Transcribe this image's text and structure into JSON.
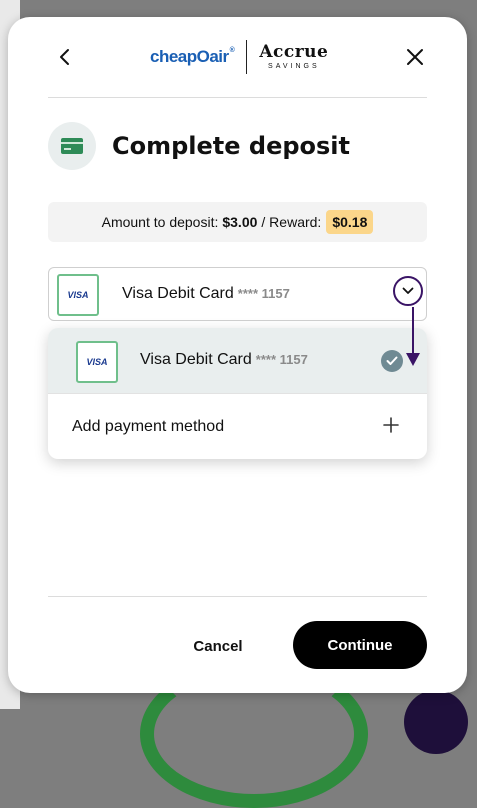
{
  "header": {
    "brand_left": "cheapOair",
    "brand_left_mark": "®",
    "brand_right": "Accrue",
    "brand_right_sub": "SAVINGS"
  },
  "title": "Complete deposit",
  "amount": {
    "label": "Amount to deposit:",
    "value": "$3.00",
    "separator": "/ Reward:",
    "reward": "$0.18"
  },
  "payment_select": {
    "card_brand": "VISA",
    "card_name": "Visa Debit Card",
    "card_mask": "**** 1157"
  },
  "dropdown": {
    "items": [
      {
        "card_brand": "VISA",
        "card_name": "Visa Debit Card",
        "card_mask": "**** 1157",
        "selected": true
      }
    ],
    "add_label": "Add payment method"
  },
  "footer": {
    "cancel_label": "Cancel",
    "continue_label": "Continue"
  },
  "colors": {
    "accent_purple": "#3a1466",
    "reward_badge": "#fbd68a",
    "card_border_green": "#6fbf8b",
    "continue_bg": "#000000"
  },
  "icons": {
    "back": "chevron-left-icon",
    "close": "close-icon",
    "title": "credit-card-icon",
    "dropdown": "chevron-down-icon",
    "selected": "check-circle-icon",
    "add": "plus-icon"
  }
}
